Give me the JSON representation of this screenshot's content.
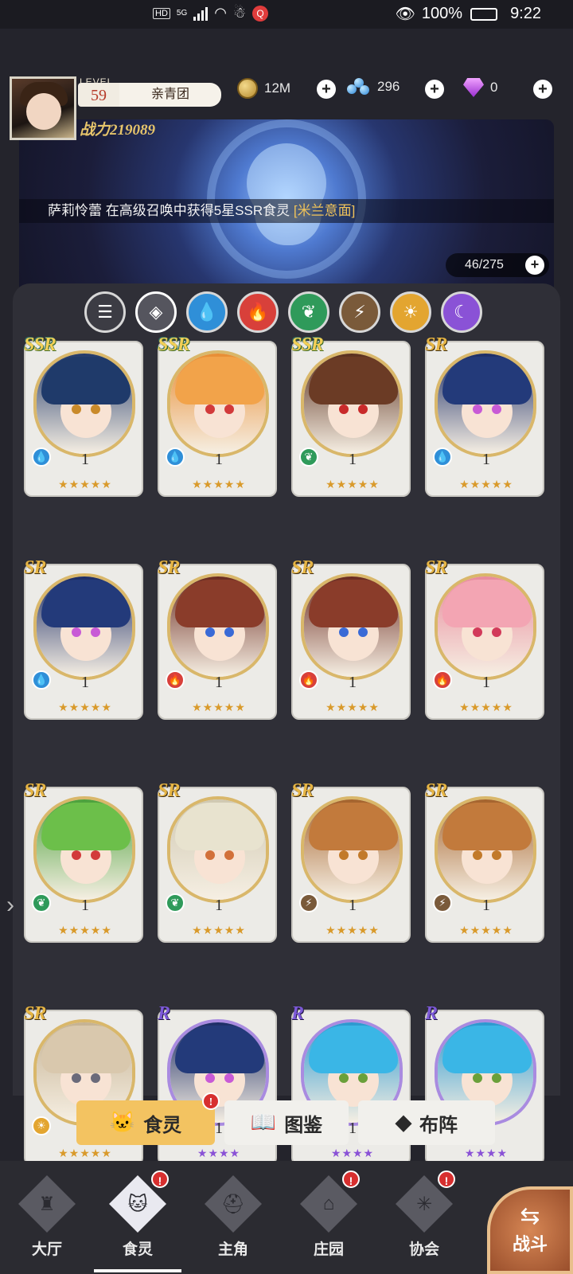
{
  "status": {
    "chip": "HD",
    "net": "5G",
    "battery": "100%",
    "time": "9:22"
  },
  "player": {
    "level_label": "LEVEL",
    "level": "59",
    "guild": "亲青团",
    "power": "战力219089"
  },
  "resources": {
    "gold": "12M",
    "crystals": "296",
    "diamonds": "0"
  },
  "ticker": {
    "prefix": "萨莉怜蕾 在高级召唤中获得5星SSR食灵 ",
    "highlight": "[米兰意面]"
  },
  "roster_count": "46/275",
  "filters": [
    "all-list",
    "diamond-all",
    "water",
    "fire",
    "leaf",
    "thunder",
    "sun",
    "moon"
  ],
  "cards": [
    {
      "rarity": "SSR",
      "level": "1",
      "element": "water",
      "stars": "★★★★★",
      "star_color": "gold"
    },
    {
      "rarity": "SSR",
      "level": "1",
      "element": "water",
      "stars": "★★★★★",
      "star_color": "gold"
    },
    {
      "rarity": "SSR",
      "level": "1",
      "element": "leaf",
      "stars": "★★★★★",
      "star_color": "gold"
    },
    {
      "rarity": "SR",
      "level": "1",
      "element": "water",
      "stars": "★★★★★",
      "star_color": "gold"
    },
    {
      "rarity": "SR",
      "level": "1",
      "element": "water",
      "stars": "★★★★★",
      "star_color": "gold"
    },
    {
      "rarity": "SR",
      "level": "1",
      "element": "fire",
      "stars": "★★★★★",
      "star_color": "gold"
    },
    {
      "rarity": "SR",
      "level": "1",
      "element": "fire",
      "stars": "★★★★★",
      "star_color": "gold"
    },
    {
      "rarity": "SR",
      "level": "1",
      "element": "fire",
      "stars": "★★★★★",
      "star_color": "gold"
    },
    {
      "rarity": "SR",
      "level": "1",
      "element": "leaf",
      "stars": "★★★★★",
      "star_color": "gold"
    },
    {
      "rarity": "SR",
      "level": "1",
      "element": "leaf",
      "stars": "★★★★★",
      "star_color": "gold"
    },
    {
      "rarity": "SR",
      "level": "1",
      "element": "thunder",
      "stars": "★★★★★",
      "star_color": "gold"
    },
    {
      "rarity": "SR",
      "level": "1",
      "element": "thunder",
      "stars": "★★★★★",
      "star_color": "gold"
    },
    {
      "rarity": "SR",
      "level": "1",
      "element": "sun",
      "stars": "★★★★★",
      "star_color": "gold"
    },
    {
      "rarity": "R",
      "level": "1",
      "element": "water",
      "stars": "★★★★",
      "star_color": "purple"
    },
    {
      "rarity": "R",
      "level": "1",
      "element": "water",
      "stars": "★★★★",
      "star_color": "purple"
    },
    {
      "rarity": "R",
      "level": "1",
      "element": "water",
      "stars": "★★★★",
      "star_color": "purple"
    }
  ],
  "subtabs": {
    "food_spirit": "食灵",
    "codex": "图鉴",
    "formation": "布阵"
  },
  "nav": {
    "lobby": "大厅",
    "food_spirit": "食灵",
    "hero": "主角",
    "manor": "庄园",
    "guild": "协会",
    "fight": "战斗"
  },
  "badge_text": "!",
  "colors": {
    "water": "#2f8fd8",
    "fire": "#d8403a",
    "leaf": "#2f9a5a",
    "thunder": "#7a5a3a",
    "sun": "#e3a530",
    "moon": "#8a52d6",
    "accent_gold": "#f3c361"
  }
}
